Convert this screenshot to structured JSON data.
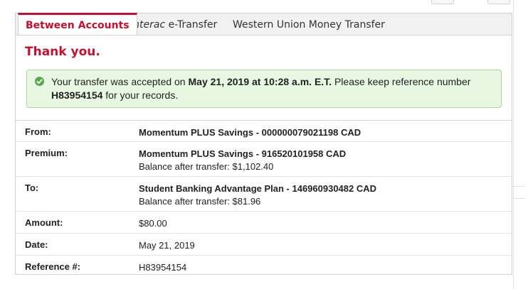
{
  "tabs": [
    {
      "label": "Between Accounts",
      "active": true
    },
    {
      "label_italic": "Interac",
      "label_rest": " e-Transfer",
      "active": false
    },
    {
      "label": "Western Union Money Transfer",
      "active": false
    }
  ],
  "confirmation": {
    "title": "Thank you.",
    "message_prefix": "Your transfer was accepted on ",
    "date_time": "May 21, 2019 at 10:28 a.m. E.T.",
    "message_mid": " Please keep reference number",
    "reference": "H83954154",
    "message_suffix": " for your records."
  },
  "details": {
    "from": {
      "label": "From:",
      "account": "Momentum PLUS Savings - 000000079021198 CAD"
    },
    "premium": {
      "label": "Premium:",
      "account": "Momentum PLUS Savings - 916520101958 CAD",
      "balance": "Balance after transfer: $1,102.40"
    },
    "to": {
      "label": "To:",
      "account": "Student Banking Advantage Plan - 146960930482 CAD",
      "balance": "Balance after transfer: $81.96"
    },
    "amount": {
      "label": "Amount:",
      "value": "$80.00"
    },
    "date": {
      "label": "Date:",
      "value": "May 21, 2019"
    },
    "reference": {
      "label": "Reference #:",
      "value": "H83954154"
    }
  },
  "colors": {
    "brand_red": "#c8102e",
    "success_bg": "#e8f7e2",
    "success_border": "#a9d79a",
    "check_green": "#5aa94e"
  }
}
